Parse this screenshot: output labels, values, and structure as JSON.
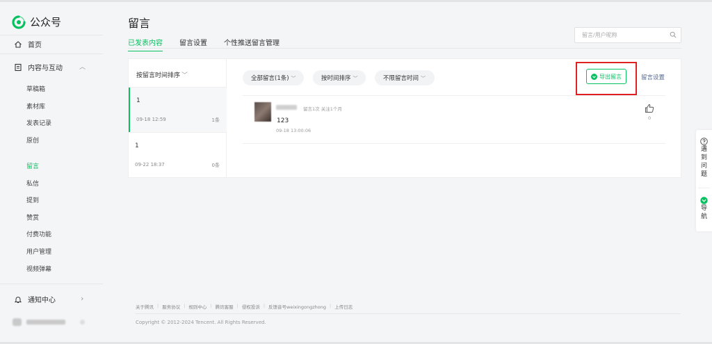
{
  "app": {
    "logo_text": "公众号",
    "accent": "#07c160",
    "highlight_color": "#e02020"
  },
  "sidebar": {
    "home": "首页",
    "content_group": "内容与互动",
    "content_items": [
      "草稿箱",
      "素材库",
      "发表记录",
      "原创"
    ],
    "interaction_items": [
      "留言",
      "私信",
      "提到",
      "赞赏",
      "付费功能",
      "用户管理",
      "视频弹幕"
    ],
    "notifications": "通知中心"
  },
  "header": {
    "title": "留言",
    "tabs": [
      "已发表内容",
      "留言设置",
      "个性推送留言管理"
    ],
    "search_placeholder": "留言/用户昵称"
  },
  "left_panel": {
    "sort_label": "按留言时间排序",
    "articles": [
      {
        "title": "1",
        "date": "09-18 12:59",
        "count": "1条"
      },
      {
        "title": "1",
        "date": "09-22 18:37",
        "count": "0条"
      }
    ]
  },
  "filters": {
    "all": "全部留言(1条)",
    "sort": "按时间排序",
    "time": "不限留言时间",
    "export": "导出留言",
    "settings": "留言设置"
  },
  "comment": {
    "meta": "留言1次 关注1个月",
    "text": "123",
    "time": "09-18 13:00:06",
    "likes": "0"
  },
  "footer": {
    "links": [
      "关于腾讯",
      "服务协议",
      "规则中心",
      "腾讯客服",
      "侵权投诉",
      "反馈音号weixingongzhong",
      "上传日志"
    ],
    "copyright": "Copyright © 2012-2024 Tencent. All Rights Reserved."
  },
  "floating": {
    "help": "遇到问题",
    "guide": "导航"
  }
}
